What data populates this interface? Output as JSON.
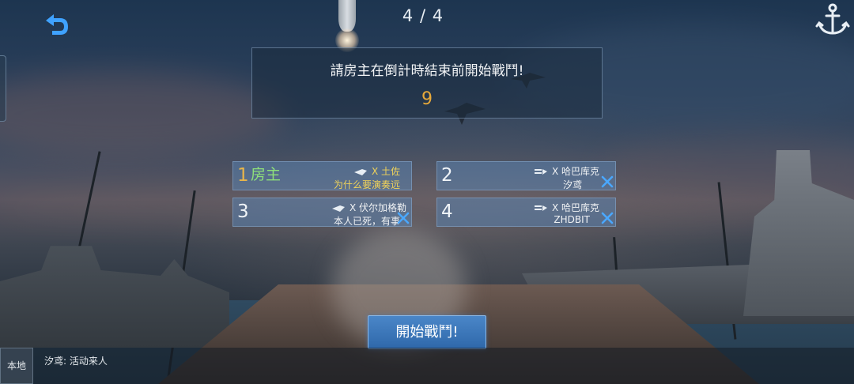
{
  "header": {
    "page_counter": "4 / 4",
    "back_icon": "back-arrow-icon",
    "anchor_icon": "anchor-icon"
  },
  "notice": {
    "message": "請房主在倒計時結束前開始戰鬥!",
    "countdown": "9"
  },
  "slots": [
    {
      "num": "1",
      "host_label": "房主",
      "ship": "X 土佐",
      "player": "为什么要演奏远",
      "highlight": true,
      "kick": false
    },
    {
      "num": "2",
      "host_label": "",
      "ship": "X 哈巴库克",
      "player": "汐鸢",
      "highlight": false,
      "kick": true
    },
    {
      "num": "3",
      "host_label": "",
      "ship": "X 伏尔加格勒",
      "player": "本人已死，有事",
      "highlight": false,
      "kick": true
    },
    {
      "num": "4",
      "host_label": "",
      "ship": "X 哈巴库克",
      "player": "ZHDBIT",
      "highlight": false,
      "kick": true
    }
  ],
  "start_button": {
    "label": "開始戰鬥!"
  },
  "chat": {
    "channel": "本地",
    "message": "汐鸢: 活动来人"
  },
  "colors": {
    "countdown": "#e8a93a",
    "host": "#8ee07a",
    "highlight_text": "#f0d35a",
    "kick": "#4aa8ff",
    "button": "#3a78bc"
  }
}
